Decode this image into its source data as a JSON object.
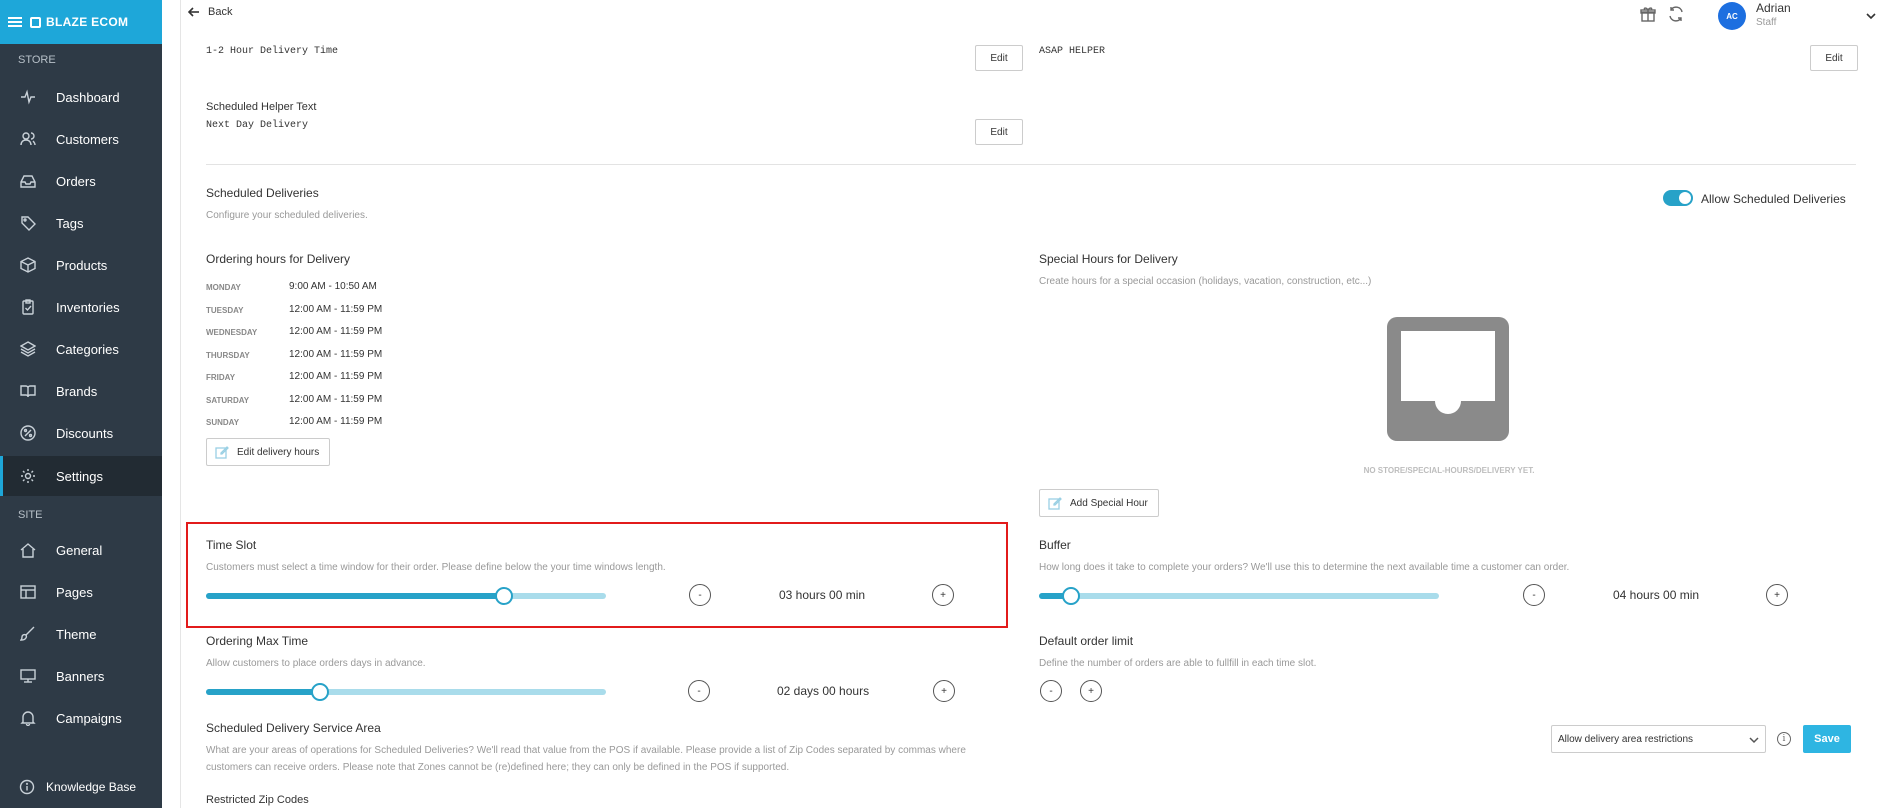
{
  "brand": {
    "name": "BLAZE ECOM"
  },
  "sidebar": {
    "sections": {
      "store": "STORE",
      "site": "SITE"
    },
    "items": [
      {
        "label": "Dashboard",
        "icon": "pulse-icon"
      },
      {
        "label": "Customers",
        "icon": "users-icon"
      },
      {
        "label": "Orders",
        "icon": "inbox-icon"
      },
      {
        "label": "Tags",
        "icon": "tag-icon"
      },
      {
        "label": "Products",
        "icon": "box-icon"
      },
      {
        "label": "Inventories",
        "icon": "clipboard-icon"
      },
      {
        "label": "Categories",
        "icon": "layers-icon"
      },
      {
        "label": "Brands",
        "icon": "book-icon"
      },
      {
        "label": "Discounts",
        "icon": "percent-icon"
      },
      {
        "label": "Settings",
        "icon": "gear-icon",
        "active": true
      },
      {
        "label": "General",
        "icon": "home-icon"
      },
      {
        "label": "Pages",
        "icon": "layout-icon"
      },
      {
        "label": "Theme",
        "icon": "brush-icon"
      },
      {
        "label": "Banners",
        "icon": "monitor-icon"
      },
      {
        "label": "Campaigns",
        "icon": "bell-icon"
      }
    ],
    "knowledge_base": "Knowledge Base"
  },
  "topbar": {
    "back": "Back",
    "user": {
      "initials": "AC",
      "name": "Adrian",
      "role": "Staff"
    }
  },
  "delivery_text": {
    "asap_value": "1-2 Hour Delivery Time",
    "asap_helper_value": "ASAP HELPER",
    "scheduled_helper_label": "Scheduled Helper Text",
    "scheduled_helper_value": "Next Day Delivery",
    "edit_label": "Edit"
  },
  "scheduled": {
    "title": "Scheduled Deliveries",
    "subtitle": "Configure your scheduled deliveries.",
    "toggle_label": "Allow Scheduled Deliveries",
    "toggle_on": true
  },
  "ordering_hours": {
    "title": "Ordering hours for Delivery",
    "days": [
      {
        "day": "MONDAY",
        "hours": "9:00 AM - 10:50 AM"
      },
      {
        "day": "TUESDAY",
        "hours": "12:00 AM - 11:59 PM"
      },
      {
        "day": "WEDNESDAY",
        "hours": "12:00 AM - 11:59 PM"
      },
      {
        "day": "THURSDAY",
        "hours": "12:00 AM - 11:59 PM"
      },
      {
        "day": "FRIDAY",
        "hours": "12:00 AM - 11:59 PM"
      },
      {
        "day": "SATURDAY",
        "hours": "12:00 AM - 11:59 PM"
      },
      {
        "day": "SUNDAY",
        "hours": "12:00 AM - 11:59 PM"
      }
    ],
    "edit_button": "Edit delivery hours"
  },
  "special_hours": {
    "title": "Special Hours for Delivery",
    "subtitle": "Create hours for a special occasion (holidays, vacation, construction, etc...)",
    "empty_text": "NO STORE/SPECIAL-HOURS/DELIVERY YET.",
    "add_button": "Add Special Hour"
  },
  "time_slot": {
    "title": "Time Slot",
    "subtitle": "Customers must select a time window for their order. Please define below the your time windows length.",
    "value": "03 hours 00 min",
    "level": 0.745,
    "minus": "-",
    "plus": "+"
  },
  "buffer": {
    "title": "Buffer",
    "subtitle": "How long does it take to complete your orders? We'll use this to determine the next available time a customer can order.",
    "value": "04 hours 00 min",
    "level": 0.08,
    "minus": "-",
    "plus": "+"
  },
  "ordering_max": {
    "title": "Ordering Max Time",
    "subtitle": "Allow customers to place orders days in advance.",
    "value": "02 days 00 hours",
    "level": 0.285,
    "minus": "-",
    "plus": "+"
  },
  "default_limit": {
    "title": "Default order limit",
    "subtitle": "Define the number of orders are able to fullfill in each time slot.",
    "minus": "-",
    "plus": "+"
  },
  "service_area": {
    "title": "Scheduled Delivery Service Area",
    "subtitle_line1": "What are your areas of operations for Scheduled Deliveries? We'll read that value from the POS if available. Please provide a list of Zip Codes separated by commas where",
    "subtitle_line2": "customers can receive orders. Please note that Zones cannot be (re)defined here; they can only be defined in the POS if supported.",
    "select_value": "Allow delivery area restrictions",
    "info": "i",
    "save": "Save",
    "restricted_label": "Restricted Zip Codes"
  }
}
